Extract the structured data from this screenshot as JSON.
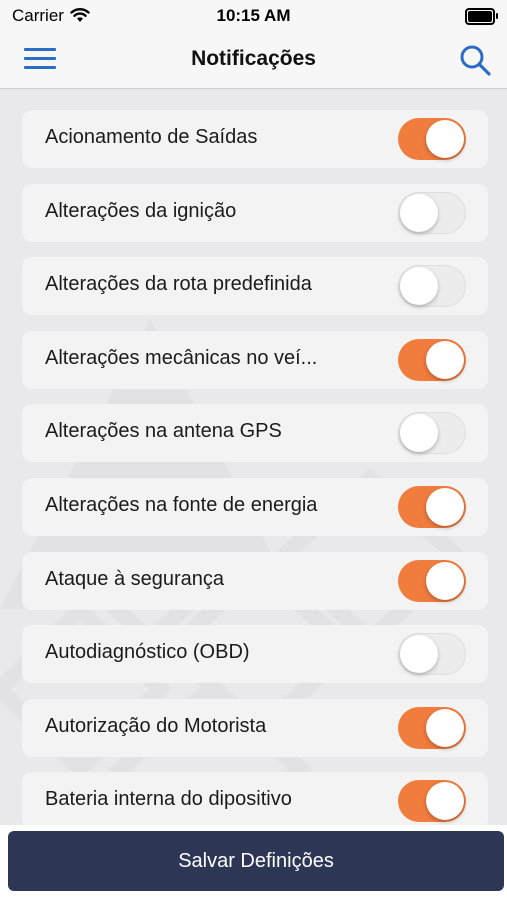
{
  "status_bar": {
    "carrier": "Carrier",
    "time": "10:15 AM"
  },
  "nav": {
    "title": "Notificações",
    "menu_icon": "hamburger-menu-icon",
    "search_icon": "search-icon"
  },
  "colors": {
    "accent": "#f07c3e",
    "primary_button": "#2d3654",
    "link": "#2b6cc4"
  },
  "notifications": [
    {
      "label": "Acionamento de Saídas",
      "enabled": true
    },
    {
      "label": "Alterações da ignição",
      "enabled": false
    },
    {
      "label": "Alterações da rota predefinida",
      "enabled": false
    },
    {
      "label": "Alterações mecânicas no veí...",
      "enabled": true
    },
    {
      "label": "Alterações na antena GPS",
      "enabled": false
    },
    {
      "label": "Alterações na fonte de energia",
      "enabled": true
    },
    {
      "label": "Ataque à segurança",
      "enabled": true
    },
    {
      "label": "Autodiagnóstico (OBD)",
      "enabled": false
    },
    {
      "label": "Autorização do Motorista",
      "enabled": true
    },
    {
      "label": "Bateria interna do dipositivo",
      "enabled": true
    }
  ],
  "footer": {
    "save_label": "Salvar Definições"
  }
}
